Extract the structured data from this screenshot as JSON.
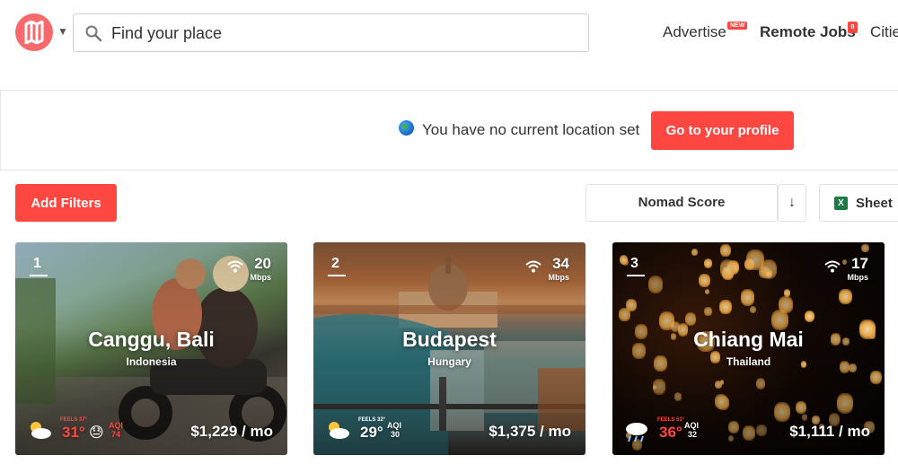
{
  "header": {
    "search_placeholder": "Find your place",
    "nav": {
      "advertise": "Advertise",
      "advertise_badge": "NEW",
      "remote_jobs": "Remote Jobs",
      "remote_jobs_badge": "0",
      "cities": "Citie"
    }
  },
  "location_bar": {
    "message": "You have no current location set",
    "profile_button": "Go to your profile"
  },
  "toolbar": {
    "filters_button": "Add Filters",
    "sort_label": "Nomad Score",
    "sort_direction": "↓",
    "sheet_label": "Sheet"
  },
  "cards": [
    {
      "rank": "1",
      "mbps": "20",
      "mbps_unit": "Mbps",
      "city": "Canggu, Bali",
      "country": "Indonesia",
      "feels": "FEELS 37°",
      "temp": "31°",
      "aqi_label": "AQI",
      "aqi": "74",
      "price": "$1,229 / mo",
      "weather_icon": "cloud-sun-icon",
      "hot": true
    },
    {
      "rank": "2",
      "mbps": "34",
      "mbps_unit": "Mbps",
      "city": "Budapest",
      "country": "Hungary",
      "feels": "FEELS 32°",
      "temp": "29°",
      "aqi_label": "AQI",
      "aqi": "30",
      "price": "$1,375 / mo",
      "weather_icon": "cloud-sun-icon",
      "hot": false
    },
    {
      "rank": "3",
      "mbps": "17",
      "mbps_unit": "Mbps",
      "city": "Chiang Mai",
      "country": "Thailand",
      "feels": "FEELS 51°",
      "temp": "36°",
      "aqi_label": "AQI",
      "aqi": "32",
      "price": "$1,111 / mo",
      "weather_icon": "cloud-rain-icon",
      "hot": true
    }
  ],
  "colors": {
    "accent": "#ff4742",
    "logo": "#f8696b",
    "excel": "#1d7a42"
  }
}
